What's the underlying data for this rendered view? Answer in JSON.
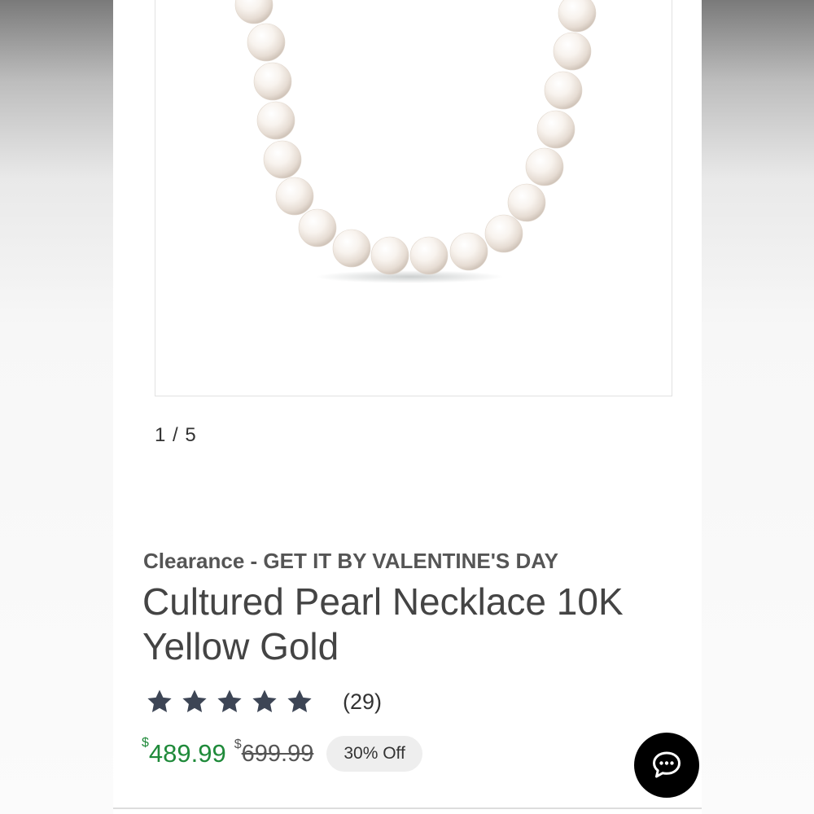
{
  "gallery": {
    "pager_text": "1 / 5"
  },
  "product": {
    "eyebrow": "Clearance - GET IT BY VALENTINE'S DAY",
    "title": "Cultured Pearl Necklace 10K Yellow Gold",
    "rating": {
      "stars": 5,
      "review_count_text": "(29)"
    },
    "price": {
      "currency_symbol": "$",
      "sale": "489.99",
      "original": "699.99",
      "discount_badge": "30% Off"
    }
  },
  "colors": {
    "sale_price": "#1f8a3a",
    "star": "#3d4555",
    "chat_button": "#000000"
  },
  "icons": {
    "chat": "chat-bubble-icon",
    "star": "star-icon"
  }
}
